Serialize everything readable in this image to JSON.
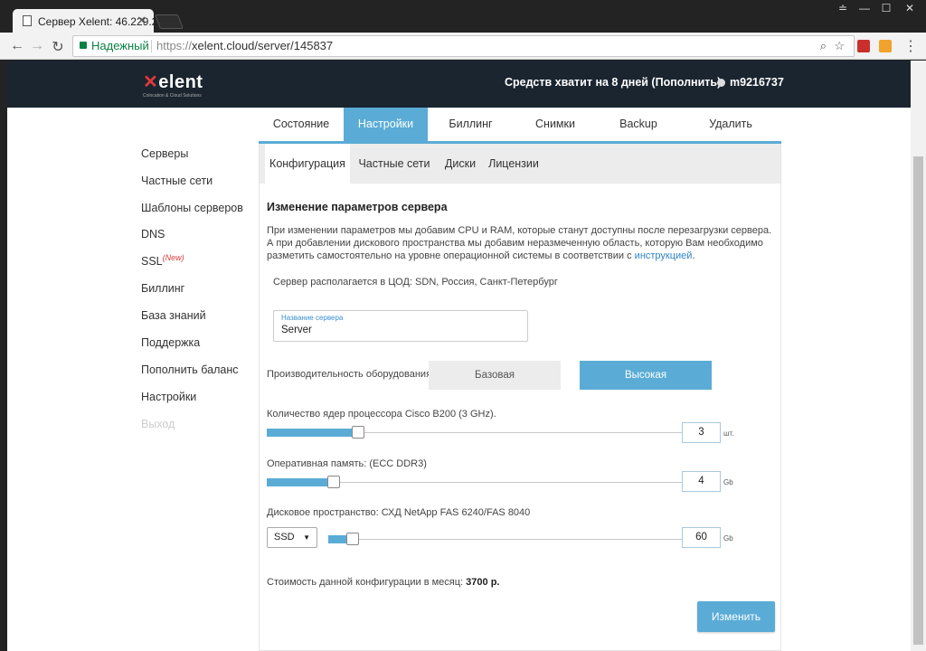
{
  "browser": {
    "tab_title": "Сервер Xelent: 46.229.2",
    "tab_close": "✕",
    "secure_label": "Надежный",
    "url_scheme": "https://",
    "url_rest": "xelent.cloud/server/145837",
    "window_controls": [
      "≐",
      "—",
      "☐",
      "✕"
    ]
  },
  "header": {
    "logo_x": "✕",
    "logo_text": "elent",
    "logo_tagline": "Colocation & Cloud Solutions",
    "balance": "Средств хватит на 8 дней (Пополнить)",
    "username": "m9216737"
  },
  "sidebar": {
    "items": [
      {
        "label": "Серверы"
      },
      {
        "label": "Частные сети"
      },
      {
        "label": "Шаблоны серверов"
      },
      {
        "label": "DNS"
      },
      {
        "label": "SSL",
        "badge": "(New)"
      },
      {
        "label": "Биллинг"
      },
      {
        "label": "База знаний"
      },
      {
        "label": "Поддержка"
      },
      {
        "label": "Пополнить баланс"
      },
      {
        "label": "Настройки"
      },
      {
        "label": "Выход"
      }
    ]
  },
  "main_tabs": [
    "Состояние",
    "Настройки",
    "Биллинг",
    "Снимки",
    "Backup",
    "Удалить"
  ],
  "active_main_tab": "Настройки",
  "sub_tabs": [
    "Конфигурация",
    "Частные сети",
    "Диски",
    "Лицензии"
  ],
  "active_sub_tab": "Конфигурация",
  "content": {
    "title": "Изменение параметров сервера",
    "desc": "При изменении параметров мы добавим CPU и RAM, которые станут доступны после перезагрузки сервера. А при добавлении дискового пространства мы добавим неразмеченную область, которую Вам необходимо разметить самостоятельно на уровне операционной системы в соответствии с ",
    "desc_link": "инструкцией",
    "desc_end": ".",
    "location": "Сервер располагается в ЦОД: SDN, Россия, Санкт-Петербург",
    "name_label": "Название сервера",
    "name_value": "Server",
    "perf_label": "Производительность оборудования",
    "perf_base": "Базовая",
    "perf_high": "Высокая",
    "cpu_label": "Количество ядер процессора Cisco B200 (3 GHz).",
    "cpu_value": "3",
    "cpu_unit": "шт.",
    "cpu_level": 0.22,
    "ram_label": "Оперативная память: (ECC DDR3)",
    "ram_value": "4",
    "ram_unit": "Gb",
    "ram_level": 0.16,
    "disk_label": "Дисковое пространство: СХД NetApp FAS 6240/FAS 8040",
    "disk_type": "SSD",
    "disk_value": "60",
    "disk_unit": "Gb",
    "disk_level": 0.07,
    "cost_label": "Стоимость данной конфигурации в месяц: ",
    "cost_value": "3700 р.",
    "submit": "Изменить"
  },
  "colors": {
    "accent": "#5aacd6",
    "header_bg": "#1a2530",
    "brand_red": "#e03a3a",
    "secure_green": "#0b8043"
  }
}
